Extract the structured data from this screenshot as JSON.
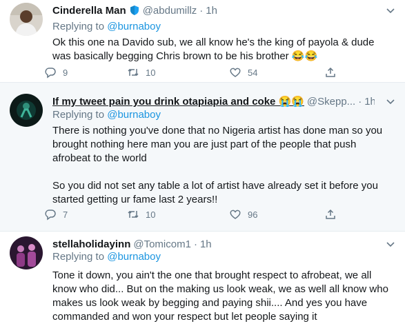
{
  "tweets": [
    {
      "name": "Cinderella Man",
      "handle": "@abdumillz",
      "time": "1h",
      "verified": true,
      "reply_prefix": "Replying to ",
      "reply_to": "@burnaboy",
      "text": "Ok this one na Davido sub, we all know he's the king of payola & dude was basically begging Chris brown to be his brother 😂😂",
      "replies": "9",
      "retweets": "10",
      "likes": "54"
    },
    {
      "name": "If my tweet pain you drink otapiapia and coke 😭😭",
      "handle": "@Skepp...",
      "time": "1h",
      "reply_prefix": "Replying to ",
      "reply_to": "@burnaboy",
      "text": "There is nothing you've done that no Nigeria artist has done man so you brought nothing here man you are just part of the people that push afrobeat to the world\n\nSo you did not set any table a lot of artist have already set it before you started getting ur fame last 2 years!!",
      "replies": "7",
      "retweets": "10",
      "likes": "96"
    },
    {
      "name": "stellaholidayinn",
      "handle": "@Tomicom1",
      "time": "1h",
      "reply_prefix": "Replying to ",
      "reply_to": "@burnaboy",
      "text": "Tone it down, you ain't the one that brought respect to afrobeat, we all know who did...  But on the making us look weak, we as well all know who makes us look weak by begging and paying shii.... And yes you have commanded and won your respect but let people saying it"
    }
  ],
  "separator": "·",
  "colors": {
    "link": "#1b95e0",
    "secondary": "#657786",
    "text": "#14171a",
    "verified": "#1da1f2"
  }
}
